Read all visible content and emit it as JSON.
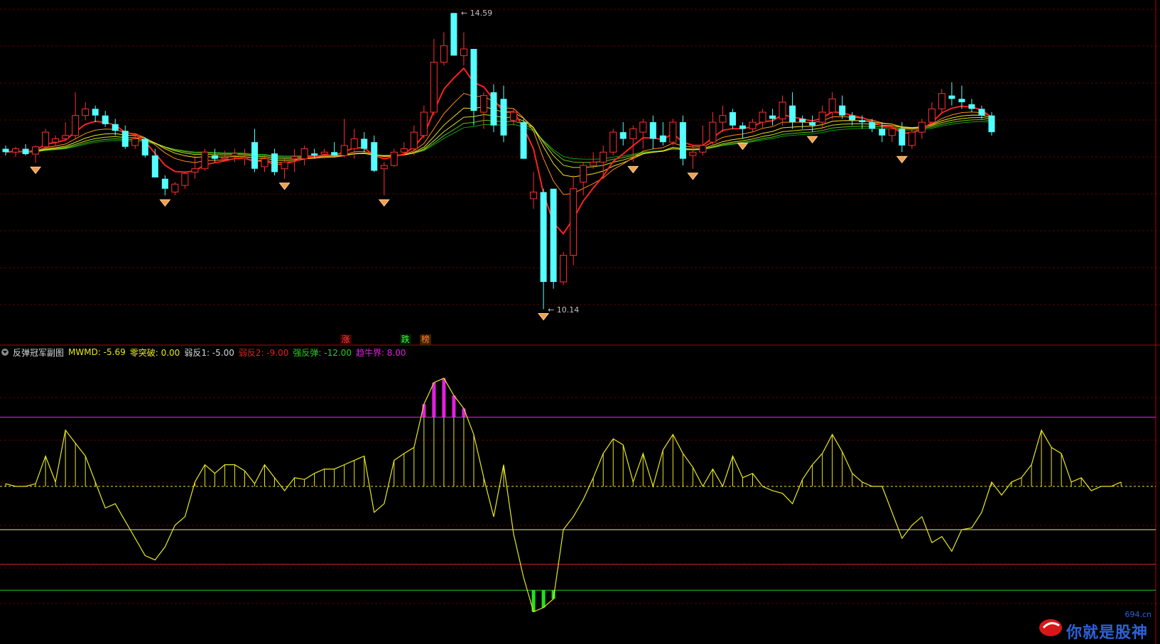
{
  "chart_data": [
    {
      "type": "candlestick",
      "panel": "price",
      "ylim": [
        9.9,
        14.7
      ],
      "high_label": "14.59",
      "low_label": "10.14",
      "grid": "dashed dark red horizontal",
      "candles": [
        [
          12.55,
          12.6,
          12.45,
          12.5
        ],
        [
          12.5,
          12.58,
          12.43,
          12.55
        ],
        [
          12.55,
          12.62,
          12.45,
          12.47
        ],
        [
          12.47,
          12.6,
          12.34,
          12.58
        ],
        [
          12.58,
          12.85,
          12.55,
          12.8
        ],
        [
          12.65,
          12.75,
          12.6,
          12.7
        ],
        [
          12.7,
          12.95,
          12.68,
          12.75
        ],
        [
          12.75,
          13.4,
          12.7,
          13.05
        ],
        [
          13.05,
          13.25,
          12.98,
          13.15
        ],
        [
          13.15,
          13.2,
          12.95,
          13.05
        ],
        [
          13.05,
          13.12,
          12.88,
          12.92
        ],
        [
          12.92,
          13.0,
          12.75,
          12.82
        ],
        [
          12.82,
          12.9,
          12.55,
          12.58
        ],
        [
          12.6,
          12.75,
          12.55,
          12.7
        ],
        [
          12.7,
          12.72,
          12.42,
          12.45
        ],
        [
          12.45,
          12.55,
          12.12,
          12.12
        ],
        [
          12.1,
          12.15,
          11.85,
          11.95
        ],
        [
          11.9,
          12.05,
          11.85,
          12.02
        ],
        [
          12.0,
          12.2,
          11.95,
          12.18
        ],
        [
          12.2,
          12.45,
          12.1,
          12.25
        ],
        [
          12.25,
          12.55,
          12.22,
          12.5
        ],
        [
          12.45,
          12.55,
          12.35,
          12.4
        ],
        [
          12.4,
          12.52,
          12.38,
          12.42
        ],
        [
          12.45,
          12.55,
          12.35,
          12.48
        ],
        [
          12.4,
          12.55,
          12.3,
          12.42
        ],
        [
          12.65,
          12.85,
          12.2,
          12.25
        ],
        [
          12.28,
          12.45,
          12.2,
          12.4
        ],
        [
          12.48,
          12.55,
          12.15,
          12.2
        ],
        [
          12.25,
          12.4,
          12.1,
          12.35
        ],
        [
          12.4,
          12.55,
          12.2,
          12.43
        ],
        [
          12.4,
          12.6,
          12.3,
          12.55
        ],
        [
          12.48,
          12.55,
          12.4,
          12.45
        ],
        [
          12.47,
          12.55,
          12.4,
          12.5
        ],
        [
          12.5,
          12.65,
          12.42,
          12.45
        ],
        [
          12.45,
          13.0,
          12.42,
          12.6
        ],
        [
          12.55,
          12.85,
          12.4,
          12.7
        ],
        [
          12.7,
          12.8,
          12.5,
          12.55
        ],
        [
          12.65,
          12.75,
          12.2,
          12.22
        ],
        [
          12.25,
          12.35,
          11.85,
          12.3
        ],
        [
          12.3,
          12.55,
          12.28,
          12.5
        ],
        [
          12.5,
          12.65,
          12.45,
          12.55
        ],
        [
          12.55,
          12.9,
          12.45,
          12.8
        ],
        [
          12.75,
          13.2,
          12.7,
          13.1
        ],
        [
          13.1,
          14.2,
          13.05,
          13.85
        ],
        [
          13.85,
          14.3,
          13.8,
          14.1
        ],
        [
          14.59,
          14.59,
          13.95,
          13.95
        ],
        [
          13.95,
          14.3,
          13.8,
          14.05
        ],
        [
          14.05,
          14.05,
          12.9,
          13.12
        ],
        [
          13.1,
          13.4,
          12.85,
          13.35
        ],
        [
          13.4,
          13.52,
          12.8,
          12.9
        ],
        [
          13.3,
          13.5,
          12.65,
          12.75
        ],
        [
          12.98,
          13.15,
          12.9,
          13.1
        ],
        [
          12.95,
          13.0,
          12.4,
          12.4
        ],
        [
          11.8,
          12.2,
          11.65,
          11.9
        ],
        [
          11.9,
          11.95,
          10.14,
          10.55
        ],
        [
          11.95,
          11.95,
          10.45,
          10.55
        ],
        [
          10.55,
          11.0,
          10.5,
          10.95
        ],
        [
          10.95,
          12.15,
          10.8,
          11.95
        ],
        [
          12.05,
          12.35,
          11.85,
          12.3
        ],
        [
          12.3,
          12.5,
          12.25,
          12.35
        ],
        [
          12.35,
          12.6,
          12.1,
          12.5
        ],
        [
          12.5,
          12.85,
          12.45,
          12.8
        ],
        [
          12.8,
          12.95,
          12.6,
          12.7
        ],
        [
          12.7,
          12.9,
          12.35,
          12.85
        ],
        [
          12.8,
          13.0,
          12.55,
          12.95
        ],
        [
          12.95,
          13.05,
          12.55,
          12.7
        ],
        [
          12.75,
          12.95,
          12.6,
          12.65
        ],
        [
          12.65,
          13.0,
          12.6,
          12.95
        ],
        [
          12.95,
          13.05,
          12.3,
          12.4
        ],
        [
          12.45,
          12.6,
          12.25,
          12.5
        ],
        [
          12.5,
          12.9,
          12.45,
          12.6
        ],
        [
          12.65,
          13.1,
          12.6,
          12.95
        ],
        [
          12.95,
          13.2,
          12.8,
          13.05
        ],
        [
          13.1,
          13.15,
          12.85,
          12.9
        ],
        [
          12.9,
          12.95,
          12.7,
          12.85
        ],
        [
          12.85,
          13.0,
          12.8,
          12.95
        ],
        [
          12.95,
          13.15,
          12.85,
          13.1
        ],
        [
          13.05,
          13.15,
          12.9,
          13.0
        ],
        [
          13.0,
          13.35,
          12.9,
          13.25
        ],
        [
          13.2,
          13.4,
          12.85,
          12.95
        ],
        [
          13.0,
          13.05,
          12.85,
          12.95
        ],
        [
          12.95,
          13.05,
          12.8,
          12.9
        ],
        [
          12.95,
          13.2,
          12.85,
          13.1
        ],
        [
          13.1,
          13.4,
          13.0,
          13.3
        ],
        [
          13.2,
          13.35,
          13.0,
          13.05
        ],
        [
          13.05,
          13.1,
          12.9,
          12.98
        ],
        [
          12.98,
          13.05,
          12.85,
          12.95
        ],
        [
          12.95,
          13.0,
          12.8,
          12.85
        ],
        [
          12.85,
          12.95,
          12.65,
          12.75
        ],
        [
          12.75,
          12.9,
          12.65,
          12.85
        ],
        [
          12.85,
          12.95,
          12.5,
          12.6
        ],
        [
          12.6,
          12.85,
          12.55,
          12.8
        ],
        [
          12.8,
          13.0,
          12.7,
          12.95
        ],
        [
          12.95,
          13.25,
          12.9,
          13.15
        ],
        [
          13.15,
          13.45,
          13.1,
          13.38
        ],
        [
          13.35,
          13.55,
          13.2,
          13.3
        ],
        [
          13.3,
          13.5,
          13.15,
          13.25
        ],
        [
          13.22,
          13.3,
          13.1,
          13.15
        ],
        [
          13.15,
          13.2,
          13.0,
          13.05
        ],
        [
          13.05,
          13.1,
          12.75,
          12.8
        ]
      ],
      "ma_colors": [
        "#ff2020",
        "#ff8c1a",
        "#f0e020",
        "#c8e020",
        "#60c020",
        "#10a010"
      ]
    },
    {
      "type": "line",
      "panel": "indicator",
      "title": "反弹冠军副图",
      "ylim": [
        -16,
        16
      ],
      "series": [
        {
          "name": "MWMD",
          "color": "#e8e820",
          "values": [
            0.3,
            0.0,
            0.0,
            0.3,
            3.5,
            0.5,
            6.5,
            5.0,
            3.5,
            0.5,
            -2.5,
            -2.0,
            -4.0,
            -6.0,
            -8.0,
            -8.5,
            -7.0,
            -4.5,
            -3.5,
            0.5,
            2.5,
            1.5,
            2.5,
            2.5,
            1.8,
            0.3,
            2.5,
            1.0,
            -0.5,
            1.0,
            0.8,
            1.5,
            2.0,
            2.0,
            2.5,
            3.0,
            3.5,
            -3.0,
            -2.0,
            3.0,
            3.8,
            4.5,
            9.5,
            12.0,
            12.5,
            10.5,
            9.0,
            6.0,
            1.0,
            -3.5,
            2.5,
            -5.5,
            -10.5,
            -14.5,
            -14.0,
            -13.0,
            -5.0,
            -3.5,
            -1.5,
            1.0,
            3.8,
            5.5,
            4.8,
            0.5,
            3.8,
            0.0,
            4.2,
            6.0,
            3.8,
            2.2,
            0.0,
            2.0,
            0.0,
            3.5,
            1.0,
            1.5,
            0.0,
            -0.5,
            -0.8,
            -2.0,
            0.8,
            2.5,
            3.8,
            6.0,
            4.0,
            1.5,
            0.5,
            0.0,
            0.0,
            -3.0,
            -6.0,
            -4.5,
            -3.5,
            -6.5,
            -5.8,
            -7.5,
            -5.0,
            -4.8,
            -3.0,
            0.5,
            -1.0,
            0.5,
            1.0,
            2.5,
            6.5,
            4.5,
            3.8,
            0.5,
            1.0,
            -0.5,
            0.0,
            0.0,
            0.5
          ]
        },
        {
          "name": "零突破",
          "value": 0.0,
          "color": "#e8e820",
          "style": "dotted"
        },
        {
          "name": "弱反1",
          "value": -5.0,
          "color": "#e8e8a0"
        },
        {
          "name": "弱反2",
          "value": -9.0,
          "color": "#e02020"
        },
        {
          "name": "强反弹",
          "value": -12.0,
          "color": "#20d020"
        },
        {
          "name": "趋牛界",
          "value": 8.0,
          "color": "#e020e0"
        }
      ]
    }
  ],
  "indicator_header": {
    "title": "反弹冠军副图",
    "items": [
      {
        "label": "MWMD: -5.69",
        "color": "#e8e820"
      },
      {
        "label": "零突破: 0.00",
        "color": "#e8e820"
      },
      {
        "label": "弱反1: -5.00",
        "color": "#d8d8d8"
      },
      {
        "label": "弱反2: -9.00",
        "color": "#e02020"
      },
      {
        "label": "强反弹: -12.00",
        "color": "#20d020"
      },
      {
        "label": "趋牛界: 8.00",
        "color": "#e020e0"
      }
    ]
  },
  "signals": [
    {
      "text": "涨",
      "color": "#ff4040",
      "bg": "#400000"
    },
    {
      "text": "跌",
      "color": "#40ff40",
      "bg": "#002000"
    },
    {
      "text": "榜",
      "color": "#ff8030",
      "bg": "#402000"
    }
  ],
  "watermark": {
    "text": "你就是股神",
    "site": "694.cn"
  }
}
